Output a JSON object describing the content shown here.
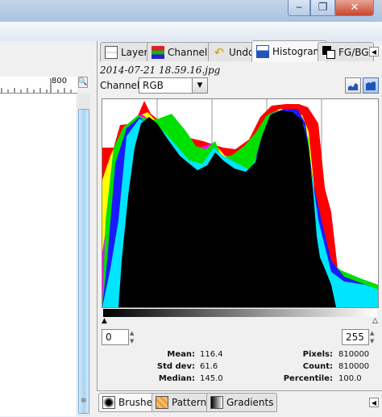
{
  "window": {
    "minimize_glyph": "─",
    "maximize_glyph": "❐",
    "close_glyph": "✕"
  },
  "ruler": {
    "label": "800"
  },
  "dock_tabs": [
    {
      "label": "Layers",
      "icon": "layers-icon"
    },
    {
      "label": "Channels",
      "icon": "channels-icon"
    },
    {
      "label": "Undo",
      "icon": "undo-icon"
    },
    {
      "label": "Histogram",
      "icon": "histogram-icon",
      "active": true
    },
    {
      "label": "FG/BG",
      "icon": "fg-bg-icon"
    }
  ],
  "histogram": {
    "filename": "2014-07-21 18.59.16.jpg",
    "channel_label": "Channel:",
    "channel_value": "RGB",
    "range_min": "0",
    "range_max": "255",
    "stats": {
      "mean_label": "Mean:",
      "mean": "116.4",
      "stddev_label": "Std dev:",
      "stddev": "61.6",
      "median_label": "Median:",
      "median": "145.0",
      "pixels_label": "Pixels:",
      "pixels": "810000",
      "count_label": "Count:",
      "count": "810000",
      "percentile_label": "Percentile:",
      "percentile": "100.0"
    },
    "colors": {
      "red": "#ff0000",
      "green": "#00e000",
      "blue": "#1a1aff",
      "cyan": "#00e5ff",
      "magenta": "#ff00ff",
      "yellow": "#ffff00",
      "black": "#000000"
    }
  },
  "bottom_tabs": [
    {
      "label": "Brushes",
      "icon": "brushes-icon",
      "active": true
    },
    {
      "label": "Patterns",
      "icon": "patterns-icon"
    },
    {
      "label": "Gradients",
      "icon": "gradients-icon"
    }
  ]
}
